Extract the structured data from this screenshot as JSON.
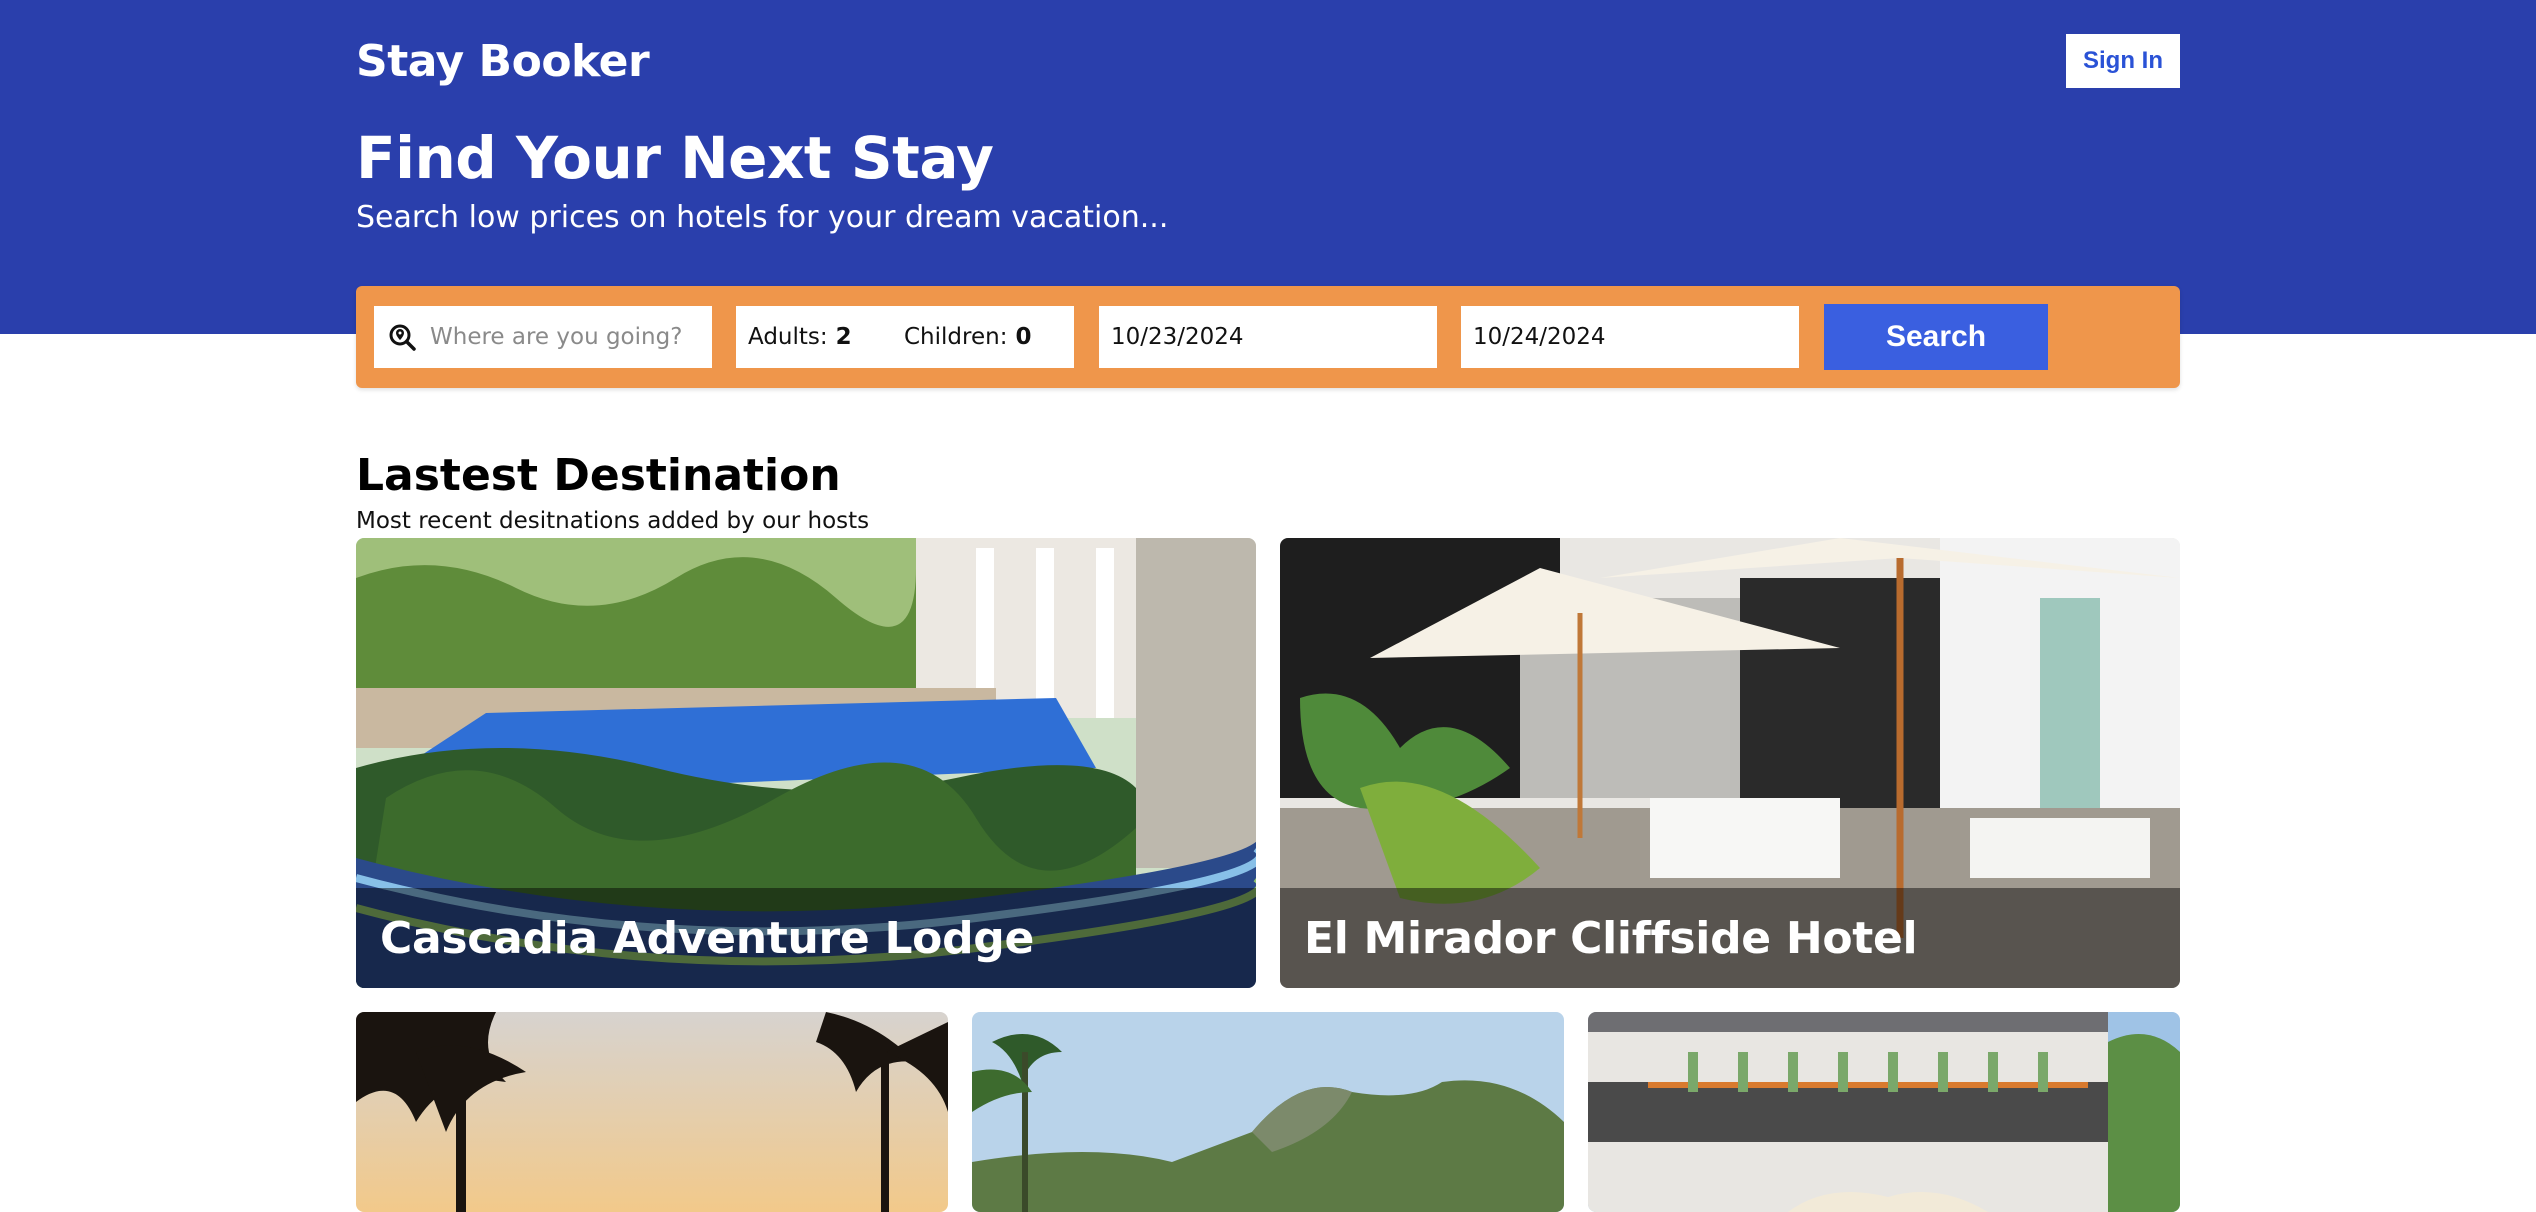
{
  "header": {
    "brand": "Stay Booker",
    "sign_in_label": "Sign In",
    "title": "Find Your Next Stay",
    "subtitle": "Search low prices on hotels for your dream vacation..."
  },
  "search": {
    "destination_placeholder": "Where are you going?",
    "adults_label": "Adults:",
    "adults_value": "2",
    "children_label": "Children:",
    "children_value": "0",
    "check_in": "10/23/2024",
    "check_out": "10/24/2024",
    "search_label": "Search",
    "bar_color": "#ef964b",
    "button_color": "#3a5fe0"
  },
  "section": {
    "title": "Lastest Destination",
    "subtitle": "Most recent desitnations added by our hosts"
  },
  "destinations": [
    {
      "name": "Cascadia Adventure Lodge"
    },
    {
      "name": "El Mirador Cliffside Hotel"
    },
    {
      "name": ""
    },
    {
      "name": ""
    },
    {
      "name": ""
    }
  ],
  "colors": {
    "hero_bg": "#2a3fac",
    "page_bg": "#ffffff"
  }
}
